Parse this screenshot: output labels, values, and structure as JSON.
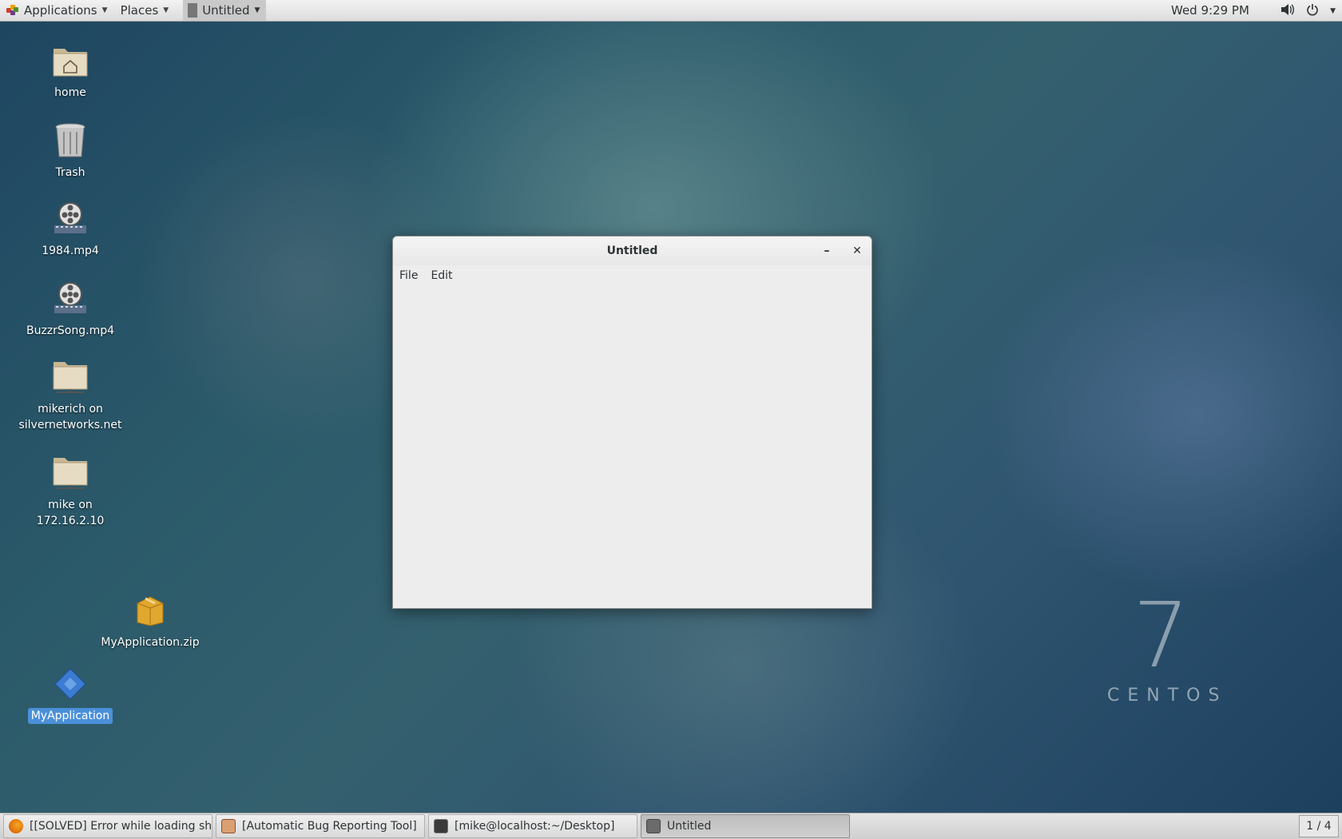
{
  "top_panel": {
    "applications_label": "Applications",
    "places_label": "Places",
    "active_window_label": "Untitled",
    "clock": "Wed  9:29 PM"
  },
  "desktop": {
    "icons": [
      {
        "label": "home"
      },
      {
        "label": "Trash"
      },
      {
        "label": "1984.mp4"
      },
      {
        "label": "BuzzrSong.mp4"
      },
      {
        "label_line1": "mikerich on",
        "label_line2": "silvernetworks.net"
      },
      {
        "label_line1": "mike on",
        "label_line2": "172.16.2.10"
      },
      {
        "label": "MyApplication.zip"
      },
      {
        "label": "MyApplication",
        "selected": true
      }
    ],
    "watermark_number": "7",
    "watermark_text": "CENTOS"
  },
  "window": {
    "title": "Untitled",
    "minimize_glyph": "–",
    "close_glyph": "✕",
    "menu": [
      "File",
      "Edit"
    ]
  },
  "taskbar": {
    "tasks": [
      {
        "label": "[[SOLVED] Error while loading sha...",
        "icon": "firefox-icon"
      },
      {
        "label": "[Automatic Bug Reporting Tool]",
        "icon": "bug-report-icon"
      },
      {
        "label": "[mike@localhost:~/Desktop]",
        "icon": "terminal-icon"
      },
      {
        "label": "Untitled",
        "icon": "window-icon",
        "active": true
      }
    ],
    "workspace": "1 / 4"
  },
  "colors": {
    "selection": "#4a90d9",
    "panel": "#e6e6e6",
    "window_bg": "#ededed"
  }
}
